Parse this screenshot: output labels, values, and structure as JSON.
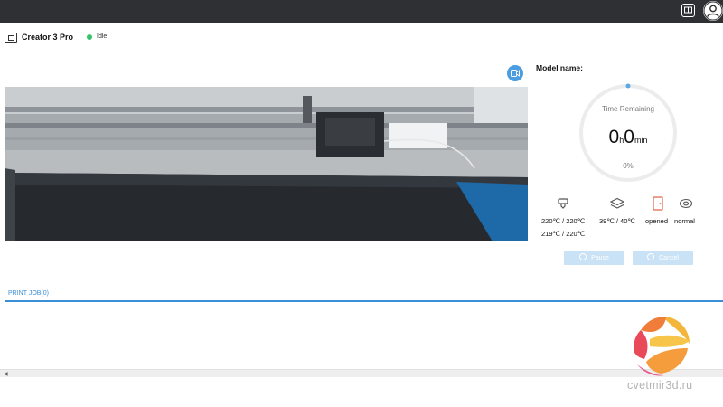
{
  "topbar": {
    "icons": [
      "window-switch-icon",
      "user-avatar-icon"
    ]
  },
  "header": {
    "printer_name": "Creator 3 Pro",
    "status": "Idle",
    "status_color": "#35c46a"
  },
  "panel": {
    "model_label": "Model name:",
    "time_remaining_label": "Time Remaining",
    "hours": "0",
    "hours_unit": "h",
    "minutes": "0",
    "minutes_unit": "min",
    "progress_text": "0%",
    "progress": 0,
    "extruder_left_temp": "220℃ / 220℃",
    "extruder_right_temp": "219℃ / 220℃",
    "bed_temp": "39℃ / 40℃",
    "door_status": "opened",
    "fan_mode": "normal",
    "pause_label": "Pause",
    "cancel_label": "Cancel"
  },
  "tabs": {
    "print_job": "PRINT JOB(0)"
  },
  "watermark": {
    "text": "cvetmir3d.ru"
  },
  "colors": {
    "accent": "#3a8fd6",
    "topbar": "#2f3033",
    "button_disabled": "#c9e2f6",
    "door_icon": "#e0664a"
  }
}
